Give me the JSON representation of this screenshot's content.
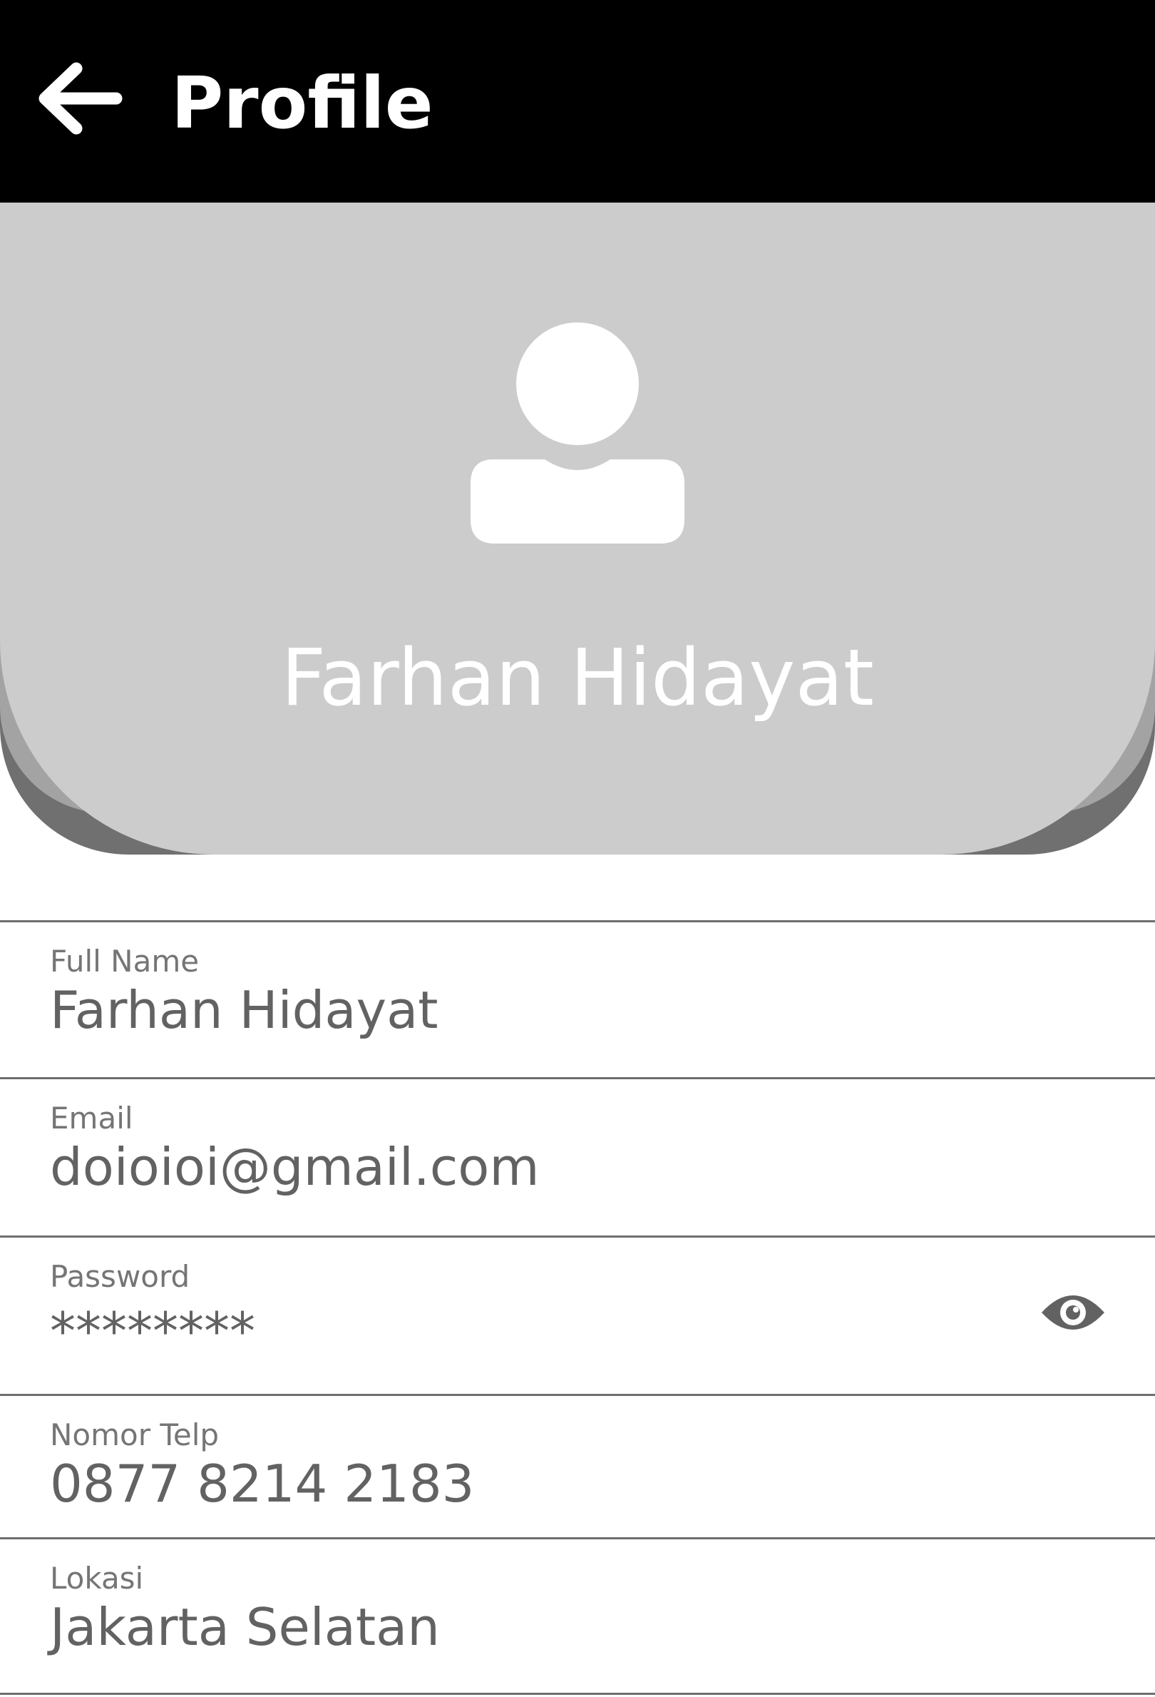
{
  "header": {
    "title": "Profile",
    "back_icon": "arrow-left-icon"
  },
  "profile": {
    "avatar_icon": "user-icon",
    "name": "Farhan Hidayat"
  },
  "fields": [
    {
      "label": "Full Name",
      "value": "Farhan Hidayat"
    },
    {
      "label": "Email",
      "value": "doioioi@gmail.com"
    },
    {
      "label": "Password",
      "value": "********",
      "toggle_icon": "eye-icon"
    },
    {
      "label": "Nomor Telp",
      "value": "0877 8214 2183"
    },
    {
      "label": "Lokasi",
      "value": "Jakarta Selatan"
    }
  ],
  "colors": {
    "header_bg": "#000000",
    "hero_bg": "#cccccc",
    "hero_shadow_mid": "#a3a3a3",
    "hero_shadow_dark": "#707070",
    "divider": "#6e6e6e",
    "label_text": "#757575",
    "value_text": "#626262"
  }
}
